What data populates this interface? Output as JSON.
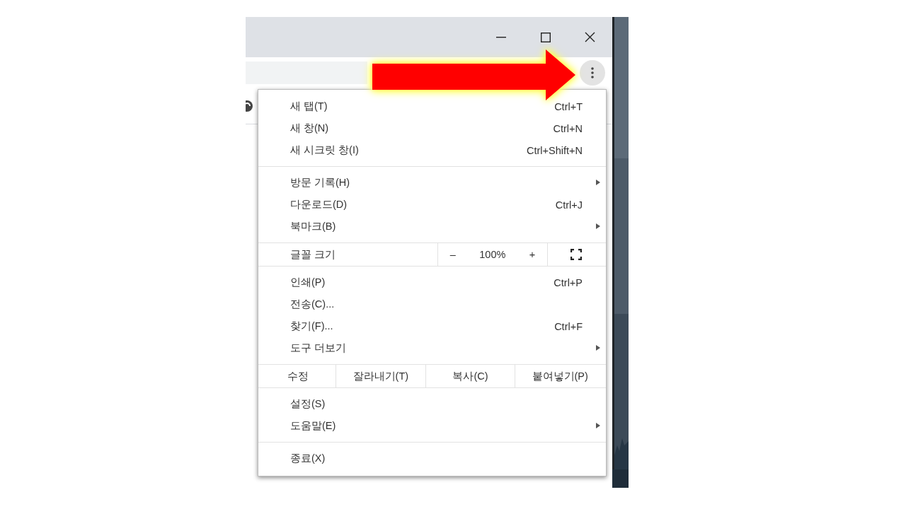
{
  "menu": {
    "sections": [
      {
        "items": [
          {
            "kind": "item",
            "label": "새 탭(T)",
            "shortcut": "Ctrl+T",
            "submenu": false
          },
          {
            "kind": "item",
            "label": "새 창(N)",
            "shortcut": "Ctrl+N",
            "submenu": false
          },
          {
            "kind": "item",
            "label": "새 시크릿 창(I)",
            "shortcut": "Ctrl+Shift+N",
            "submenu": false
          }
        ]
      },
      {
        "items": [
          {
            "kind": "item",
            "label": "방문 기록(H)",
            "submenu": true
          },
          {
            "kind": "item",
            "label": "다운로드(D)",
            "shortcut": "Ctrl+J",
            "submenu": false
          },
          {
            "kind": "item",
            "label": "북마크(B)",
            "submenu": true
          }
        ]
      },
      {
        "items": [
          {
            "kind": "zoom",
            "label": "글꼴 크기",
            "minus": "–",
            "value": "100%",
            "plus": "+"
          }
        ]
      },
      {
        "items": [
          {
            "kind": "item",
            "label": "인쇄(P)",
            "shortcut": "Ctrl+P",
            "submenu": false
          },
          {
            "kind": "item",
            "label": "전송(C)...",
            "submenu": false
          },
          {
            "kind": "item",
            "label": "찾기(F)...",
            "shortcut": "Ctrl+F",
            "submenu": false
          },
          {
            "kind": "item",
            "label": "도구 더보기",
            "submenu": true
          }
        ]
      },
      {
        "items": [
          {
            "kind": "edit",
            "label": "수정",
            "actions": [
              "잘라내기(T)",
              "복사(C)",
              "붙여넣기(P)"
            ]
          }
        ]
      },
      {
        "items": [
          {
            "kind": "item",
            "label": "설정(S)",
            "submenu": false
          },
          {
            "kind": "item",
            "label": "도움말(E)",
            "submenu": true
          }
        ]
      },
      {
        "items": [
          {
            "kind": "item",
            "label": "종료(X)",
            "submenu": false
          }
        ]
      }
    ]
  }
}
